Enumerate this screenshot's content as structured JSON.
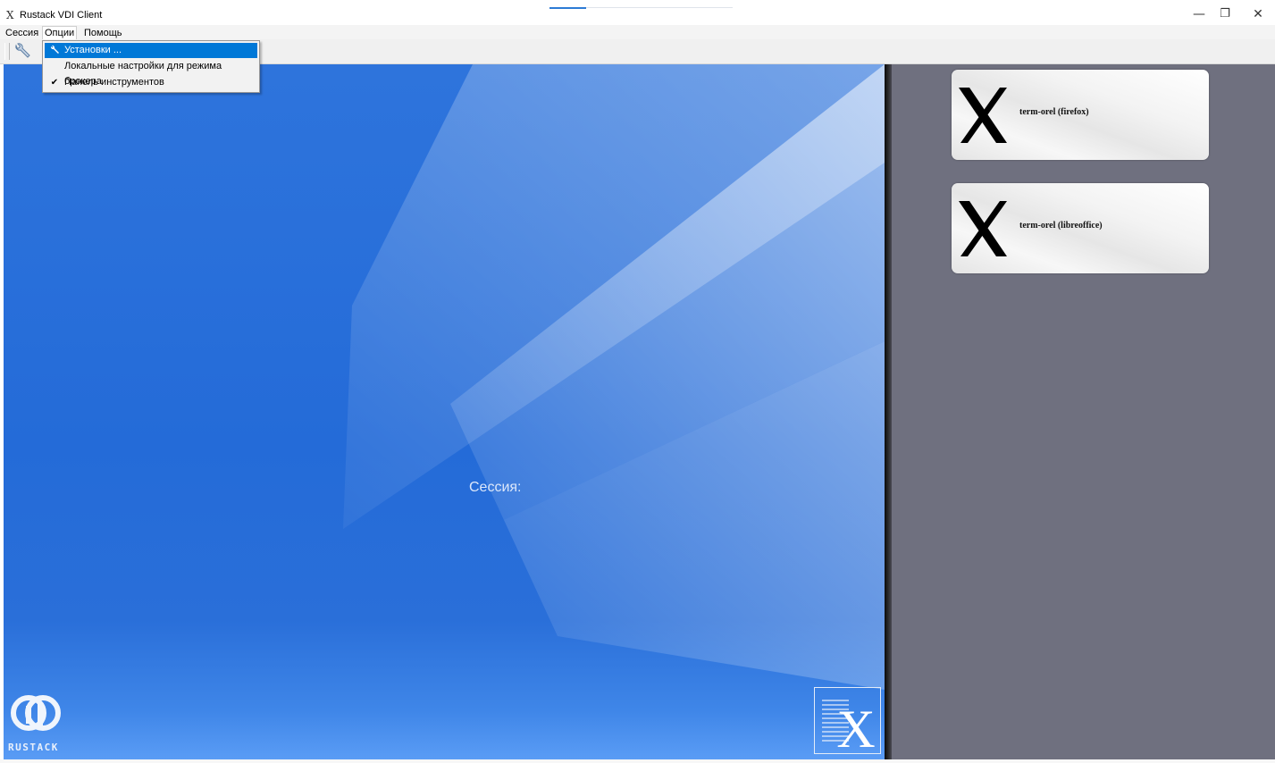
{
  "window": {
    "title": "Rustack VDI Client",
    "app_icon": "x-app-icon",
    "controls": {
      "minimize": "—",
      "restore": "❐",
      "close": "✕"
    }
  },
  "menubar": {
    "items": [
      {
        "label": "Сессия",
        "open": false
      },
      {
        "label": "Опции",
        "open": true
      },
      {
        "label": "Помощь",
        "open": false
      }
    ]
  },
  "toolbar": {
    "settings_icon": "wrench-icon"
  },
  "options_menu": {
    "items": [
      {
        "label": "Установки ...",
        "icon": "wrench-icon",
        "highlighted": true
      },
      {
        "label": "Локальные настройки для режима брокера",
        "icon": "",
        "highlighted": false
      },
      {
        "label": "Панель инструментов",
        "icon": "check-icon",
        "checked": true,
        "highlighted": false
      }
    ]
  },
  "main": {
    "session_label": "Сессия:",
    "brand_text": "RUSTACK"
  },
  "sessions": [
    {
      "label": "term-orel (firefox)"
    },
    {
      "label": "term-orel (libreoffice)"
    }
  ],
  "colors": {
    "accent": "#0078d7",
    "background_blue": "#2a6fd9",
    "panel_gray": "#6f707f"
  }
}
